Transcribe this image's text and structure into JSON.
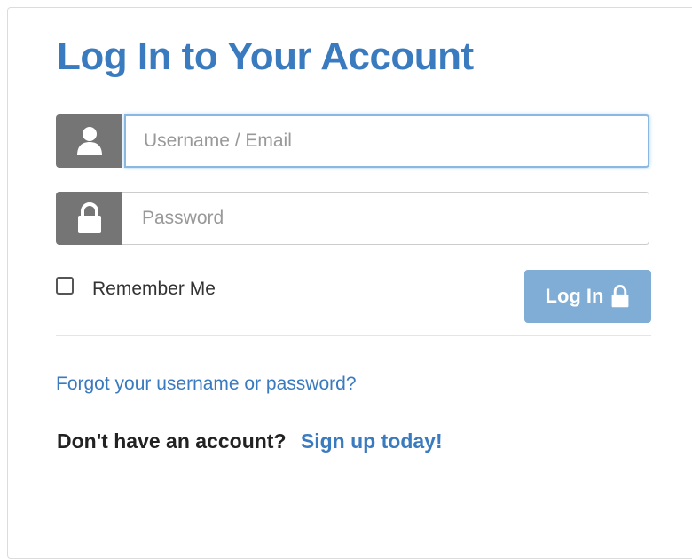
{
  "login": {
    "title": "Log In to Your Account",
    "username_placeholder": "Username / Email",
    "password_placeholder": "Password",
    "remember_label": "Remember Me",
    "login_button_label": "Log In",
    "forgot_link": "Forgot your username or password?",
    "no_account_text": "Don't have an account?",
    "signup_link": "Sign up today!"
  },
  "icons": {
    "username_addon": "user-icon",
    "password_addon": "lock-icon",
    "login_button": "lock-icon"
  },
  "colors": {
    "title": "#3a7abf",
    "link": "#3a7abf",
    "addon_background": "#757575",
    "button_background": "#7fadd6",
    "focus_border": "#8ab8e0"
  }
}
